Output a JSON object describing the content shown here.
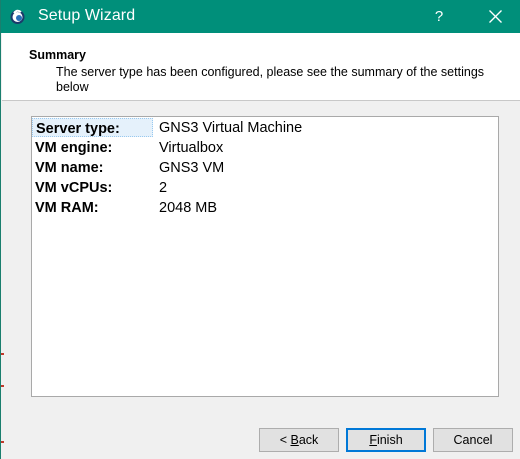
{
  "window": {
    "title": "Setup Wizard",
    "help_label": "?",
    "accent_color": "#008f7a"
  },
  "header": {
    "title": "Summary",
    "subtitle": "The server type has been configured, please see the summary of the settings below"
  },
  "summary": {
    "rows": [
      {
        "key": "Server type:",
        "value": "GNS3 Virtual Machine"
      },
      {
        "key": "VM engine:",
        "value": "Virtualbox"
      },
      {
        "key": "VM name:",
        "value": "GNS3 VM"
      },
      {
        "key": "VM vCPUs:",
        "value": "2"
      },
      {
        "key": "VM RAM:",
        "value": "2048 MB"
      }
    ]
  },
  "buttons": {
    "back_prefix": "< ",
    "back_mnemonic": "B",
    "back_rest": "ack",
    "finish_mnemonic": "F",
    "finish_rest": "inish",
    "cancel_label": "Cancel"
  }
}
